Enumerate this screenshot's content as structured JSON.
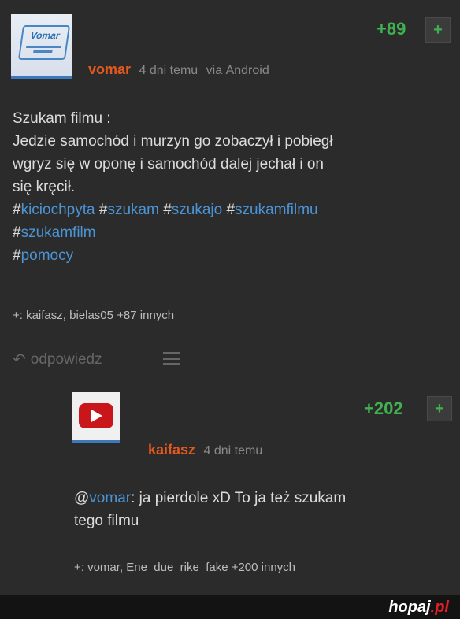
{
  "post": {
    "score": "+89",
    "plus": "+",
    "author": "vomar",
    "avatar_text": "Vomar",
    "time": "4 dni temu",
    "via": "via",
    "device": "Android",
    "lines": [
      "Szukam filmu :",
      "Jedzie samochód i murzyn go zobaczył i pobiegł",
      "wgryz się w oponę i samochód dalej jechał i on",
      "się kręcił."
    ],
    "tags_line1": [
      "kiciochpyta",
      "szukam",
      "szukajo",
      "szukamfilmu"
    ],
    "tags_line2": [
      "szukamfilm"
    ],
    "tags_line3": [
      "pomocy"
    ],
    "voters": "+: kaifasz, bielas05 +87 innych",
    "reply_label": "odpowiedz"
  },
  "reply": {
    "score": "+202",
    "plus": "+",
    "author": "kaifasz",
    "time": "4 dni temu",
    "mention": "vomar",
    "text_line1_rest": ": ja pierdole xD To ja też szukam",
    "text_line2": "tego filmu",
    "voters": "+: vomar, Ene_due_rike_fake +200 innych"
  },
  "footer": {
    "brand_name": "hopaj",
    "brand_tld": ".pl"
  },
  "colors": {
    "background": "#2b2b2b",
    "score_green": "#3fb14f",
    "author_orange": "#e4581e",
    "tag_blue": "#4b95d6"
  },
  "icons": {
    "reply": "reply-arrow-icon",
    "menu": "hamburger-menu-icon",
    "youtube": "youtube-logo-icon"
  }
}
